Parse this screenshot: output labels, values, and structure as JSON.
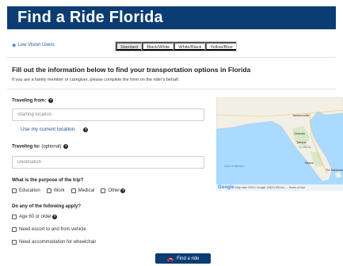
{
  "header": {
    "title": "Find a Ride Florida"
  },
  "accessibility": {
    "low_vision_link": "Low Vision Users",
    "contrast_options": [
      "Standard",
      "Black/White",
      "White/Black",
      "Yellow/Blue"
    ],
    "active_option": "Standard"
  },
  "intro": {
    "heading": "Fill out the information below to find your transportation options in Florida",
    "subtext": "If you are a family member or caregiver, please complete the form on the rider's behalf."
  },
  "from": {
    "label": "Traveling from:",
    "placeholder": "Starting location",
    "current_location_link": "Use my current location"
  },
  "to": {
    "label": "Traveling to:",
    "optional": "(optional)",
    "placeholder": "Destination"
  },
  "purpose": {
    "question": "What is the purpose of the trip?",
    "options": [
      "Education",
      "Work",
      "Medical",
      "Other"
    ]
  },
  "apply": {
    "question": "Do any of the following apply?",
    "options": [
      "Age 60 or older",
      "Need escort to and from vehicle",
      "Need accommodation for wheelchair"
    ]
  },
  "map": {
    "logo": "Google",
    "footer": "Map data ©2021 Google, INEGI   200 km ⎯⎯   Terms of Use",
    "labels": {
      "tampa": "Tampa",
      "florida": "FLORIDA",
      "jacksonville": "Jacksonville",
      "orlando": "Orlando",
      "miami": "Miami",
      "gulf": "Gulf of Mexico",
      "bahamas": "The Bahamas"
    }
  },
  "submit": {
    "label": "Find a ride"
  }
}
